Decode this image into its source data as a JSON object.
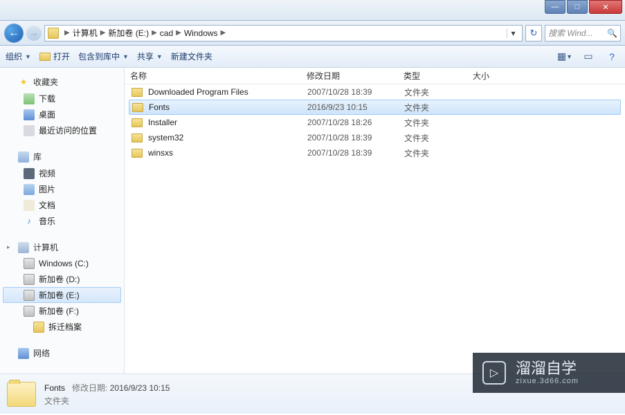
{
  "window_controls": {
    "min": "—",
    "max": "□",
    "close": "✕"
  },
  "nav": {
    "back": "←",
    "forward": "→",
    "crumbs": [
      "计算机",
      "新加卷 (E:)",
      "cad",
      "Windows"
    ],
    "refresh": "↻",
    "search_placeholder": "搜索 Wind..."
  },
  "toolbar": {
    "organize": "组织",
    "open": "打开",
    "include": "包含到库中",
    "share": "共享",
    "new_folder": "新建文件夹"
  },
  "sidebar": {
    "favorites": {
      "label": "收藏夹",
      "items": [
        {
          "label": "下载",
          "icon": "sicon-dl"
        },
        {
          "label": "桌面",
          "icon": "sicon-desk"
        },
        {
          "label": "最近访问的位置",
          "icon": "sicon-recent"
        }
      ]
    },
    "libraries": {
      "label": "库",
      "items": [
        {
          "label": "视频",
          "icon": "sicon-vid"
        },
        {
          "label": "图片",
          "icon": "sicon-pic"
        },
        {
          "label": "文档",
          "icon": "sicon-doc"
        },
        {
          "label": "音乐",
          "icon": "sicon-music",
          "glyph": "♪"
        }
      ]
    },
    "computer": {
      "label": "计算机",
      "items": [
        {
          "label": "Windows  (C:)",
          "icon": "sicon-drive"
        },
        {
          "label": "新加卷 (D:)",
          "icon": "sicon-drive"
        },
        {
          "label": "新加卷 (E:)",
          "icon": "sicon-drive",
          "selected": true
        },
        {
          "label": "新加卷 (F:)",
          "icon": "sicon-drive"
        },
        {
          "label": "拆迁档案",
          "icon": "sicon-folder",
          "sub": true
        }
      ]
    },
    "network": {
      "label": "网络"
    }
  },
  "columns": {
    "name": "名称",
    "date": "修改日期",
    "type": "类型",
    "size": "大小"
  },
  "files": [
    {
      "name": "Downloaded Program Files",
      "date": "2007/10/28 18:39",
      "type": "文件夹"
    },
    {
      "name": "Fonts",
      "date": "2016/9/23 10:15",
      "type": "文件夹",
      "selected": true
    },
    {
      "name": "Installer",
      "date": "2007/10/28 18:26",
      "type": "文件夹"
    },
    {
      "name": "system32",
      "date": "2007/10/28 18:39",
      "type": "文件夹"
    },
    {
      "name": "winsxs",
      "date": "2007/10/28 18:39",
      "type": "文件夹"
    }
  ],
  "details": {
    "name": "Fonts",
    "date_label": "修改日期:",
    "date": "2016/9/23 10:15",
    "type": "文件夹"
  },
  "watermark": {
    "main": "溜溜自学",
    "sub": "zixue.3d66.com"
  }
}
